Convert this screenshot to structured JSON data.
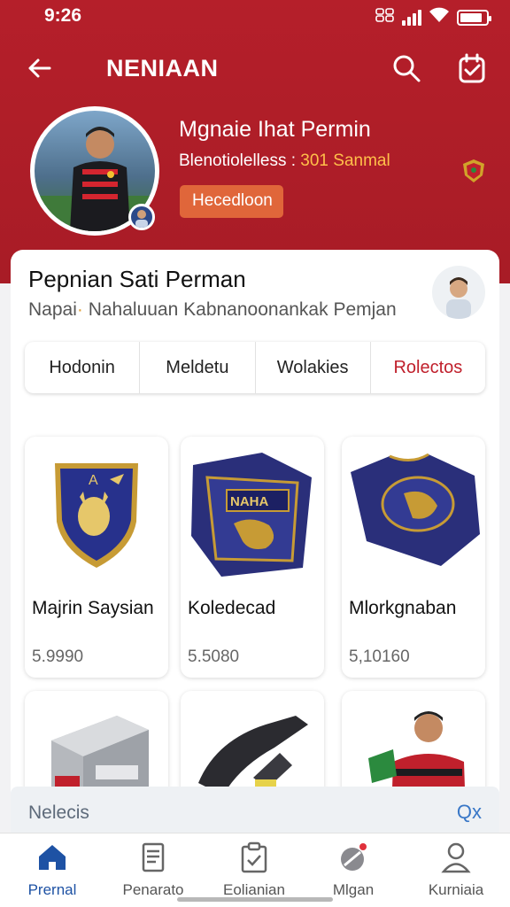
{
  "status_bar": {
    "time": "9:26",
    "icons": [
      "sim-icon",
      "signal-icon",
      "wifi-icon",
      "battery-icon"
    ],
    "battery_level": 0.85
  },
  "app_bar": {
    "title": "NENIAAN",
    "back_icon": "back-arrow-icon",
    "actions": [
      "search-icon",
      "clipboard-check-icon"
    ]
  },
  "profile": {
    "name": "Mgnaie Ihat Permin",
    "stat_label": "Blenotiolelless : ",
    "stat_value": "301 Sanmal",
    "button_label": "Hecedloon"
  },
  "section": {
    "title": "Pepnian Sati Perman",
    "subtitle_start": "Napai",
    "subtitle_separator": "·",
    "subtitle_rest": " Nahaluuan Kabnanoonankak Pemjan"
  },
  "tabs": [
    {
      "label": "Hodonin",
      "active": false
    },
    {
      "label": "Meldetu",
      "active": false
    },
    {
      "label": "Wolakies",
      "active": false
    },
    {
      "label": "Rolectos",
      "active": true
    }
  ],
  "products": [
    {
      "name": "Majrin Saysian",
      "price": "5.9990"
    },
    {
      "name": "Koledecad",
      "price": "5.5080"
    },
    {
      "name": "Mlorkgnaban",
      "price": "5,10160"
    }
  ],
  "notice": {
    "label": "Nelecis",
    "action": "Qx"
  },
  "bottom_nav": [
    {
      "label": "Prernal",
      "icon": "home-icon",
      "active": true
    },
    {
      "label": "Penarato",
      "icon": "document-icon",
      "active": false
    },
    {
      "label": "Eolianian",
      "icon": "clipboard-icon",
      "active": false
    },
    {
      "label": "Mlgan",
      "icon": "shuttlecock-icon",
      "active": false
    },
    {
      "label": "Kurniaia",
      "icon": "user-icon",
      "active": false
    }
  ],
  "colors": {
    "brand_red": "#b51f2a",
    "button_orange": "#e0663a",
    "active_blue": "#1e52a4",
    "stat_highlight": "#ffc04a"
  }
}
